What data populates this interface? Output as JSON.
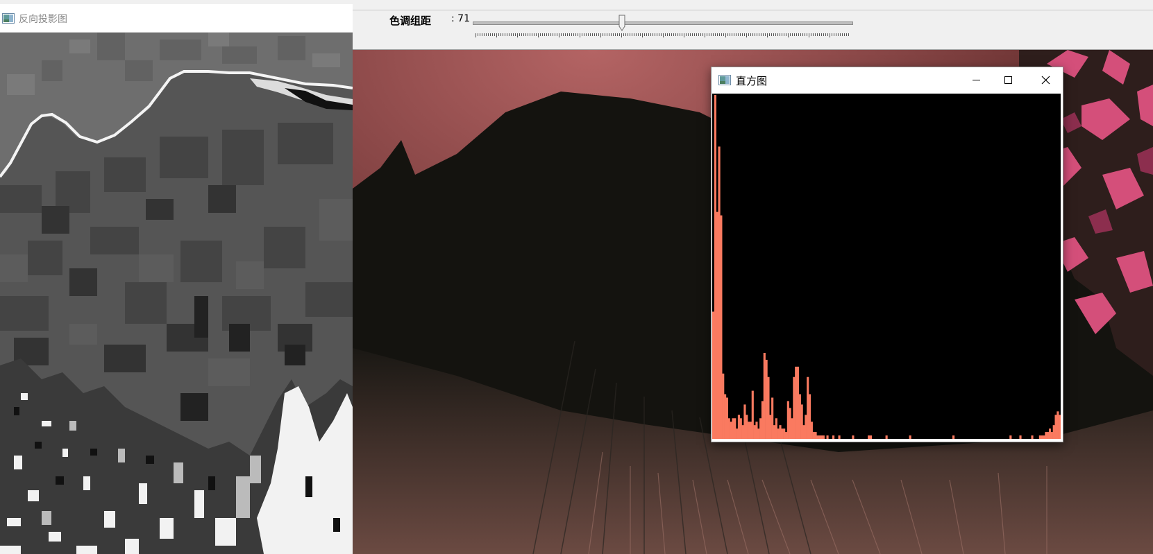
{
  "backproj_window": {
    "title": "反向投影图"
  },
  "main_window": {
    "trackbar": {
      "label": "色调组距",
      "value_text": ": 71",
      "value": 71,
      "max": 180
    }
  },
  "histogram_window": {
    "title": "直方图",
    "bar_color": "#fa7a60",
    "bins_relative_height": [
      0.37,
      1.0,
      0.66,
      0.85,
      0.65,
      0.19,
      0.13,
      0.12,
      0.06,
      0.05,
      0.06,
      0.06,
      0.03,
      0.07,
      0.06,
      0.04,
      0.1,
      0.07,
      0.05,
      0.05,
      0.14,
      0.04,
      0.05,
      0.03,
      0.06,
      0.11,
      0.25,
      0.23,
      0.18,
      0.07,
      0.12,
      0.04,
      0.06,
      0.03,
      0.04,
      0.03,
      0.03,
      0.02,
      0.11,
      0.09,
      0.06,
      0.18,
      0.21,
      0.21,
      0.13,
      0.1,
      0.04,
      0.07,
      0.18,
      0.13,
      0.05,
      0.02,
      0.02,
      0.01,
      0.01,
      0.01,
      0.01,
      0.0,
      0.01,
      0.0,
      0.0,
      0.01,
      0.0,
      0.0,
      0.01,
      0.0,
      0.0,
      0.0,
      0.0,
      0.0,
      0.0,
      0.01,
      0.0,
      0.0,
      0.0,
      0.0,
      0.0,
      0.0,
      0.0,
      0.01,
      0.01,
      0.0,
      0.0,
      0.0,
      0.0,
      0.0,
      0.0,
      0.0,
      0.01,
      0.0,
      0.0,
      0.0,
      0.0,
      0.0,
      0.0,
      0.0,
      0.0,
      0.0,
      0.0,
      0.0,
      0.01,
      0.0,
      0.0,
      0.0,
      0.0,
      0.0,
      0.0,
      0.0,
      0.0,
      0.0,
      0.0,
      0.0,
      0.0,
      0.0,
      0.0,
      0.0,
      0.0,
      0.0,
      0.0,
      0.0,
      0.0,
      0.0,
      0.01,
      0.0,
      0.0,
      0.0,
      0.0,
      0.0,
      0.0,
      0.0,
      0.0,
      0.0,
      0.0,
      0.0,
      0.0,
      0.0,
      0.0,
      0.0,
      0.0,
      0.0,
      0.0,
      0.0,
      0.0,
      0.0,
      0.0,
      0.0,
      0.0,
      0.0,
      0.0,
      0.0,
      0.0,
      0.01,
      0.0,
      0.0,
      0.0,
      0.0,
      0.01,
      0.0,
      0.0,
      0.0,
      0.0,
      0.0,
      0.01,
      0.0,
      0.0,
      0.0,
      0.01,
      0.01,
      0.01,
      0.02,
      0.02,
      0.03,
      0.02,
      0.04,
      0.07,
      0.08,
      0.07
    ]
  }
}
